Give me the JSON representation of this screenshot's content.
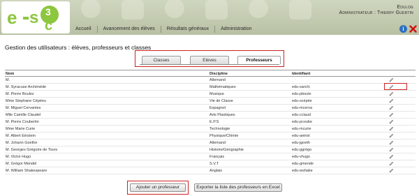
{
  "header": {
    "app_name": "Edulog",
    "user_line": "Administrateur : Thierry Guertin",
    "logo": "e-s3c"
  },
  "nav": {
    "items": [
      {
        "label": "Accueil"
      },
      {
        "label": "Avancement des élèves"
      },
      {
        "label": "Résultats généraux"
      },
      {
        "label": "Administration"
      }
    ],
    "icons": [
      "info-icon",
      "close-icon"
    ]
  },
  "page": {
    "title": "Gestion des utilisateurs : élèves, professeurs et classes"
  },
  "tabs": [
    {
      "label": "Classes",
      "active": false
    },
    {
      "label": "Elèves",
      "active": false
    },
    {
      "label": "Professeurs",
      "active": true
    }
  ],
  "table": {
    "columns": [
      "Nom",
      "Discipline",
      "Identifiant",
      ""
    ],
    "rows": [
      {
        "nom": "M.",
        "discipline": "Allemand",
        "identifiant": ""
      },
      {
        "nom": "M. Syracuse Archimède",
        "discipline": "Mathématiques",
        "identifiant": "edu-sarchi"
      },
      {
        "nom": "M. Pierre Boulez",
        "discipline": "Musique",
        "identifiant": "edu-pboule"
      },
      {
        "nom": "Mme Stephane Cépéeu",
        "discipline": "Vie de Classe",
        "identifiant": "edu-scépée"
      },
      {
        "nom": "M. Miguel Cervantes",
        "discipline": "Espagnol",
        "identifiant": "edu-mcerva"
      },
      {
        "nom": "Mlle Camille Claudel",
        "discipline": "Arts Plastiques",
        "identifiant": "edu-cclaud"
      },
      {
        "nom": "M. Pierre Coubertin",
        "discipline": "E.P.S",
        "identifiant": "edu-pcoube"
      },
      {
        "nom": "Mme Marie Curie",
        "discipline": "Technologie",
        "identifiant": "edu-mcurie"
      },
      {
        "nom": "M. Albert Einstein",
        "discipline": "Physique/Chimie",
        "identifiant": "edu-aeinst"
      },
      {
        "nom": "M. Johann Goethe",
        "discipline": "Allemand",
        "identifiant": "edu-jgoeth"
      },
      {
        "nom": "M. Georges Grégoire de Tours",
        "discipline": "Histoire/Géographie",
        "identifiant": "edu-ggrégo"
      },
      {
        "nom": "M. Victor Hugo",
        "discipline": "Français",
        "identifiant": "edu-vhugo"
      },
      {
        "nom": "M. Grégor Mendel",
        "discipline": "S.V.T",
        "identifiant": "edu-gmende"
      },
      {
        "nom": "M. William Shakespeare",
        "discipline": "Anglais",
        "identifiant": "edu-wshake"
      }
    ],
    "row_action_icon": "pencil-icon"
  },
  "buttons": {
    "add": "Ajouter un professeur",
    "export": "Exporter la liste des professeurs en Excel"
  },
  "colors": {
    "header_bg": "#c4ccb1",
    "logo_green": "#8dc63f",
    "highlight_red": "#cc2222",
    "info_blue": "#2d6fc2"
  }
}
